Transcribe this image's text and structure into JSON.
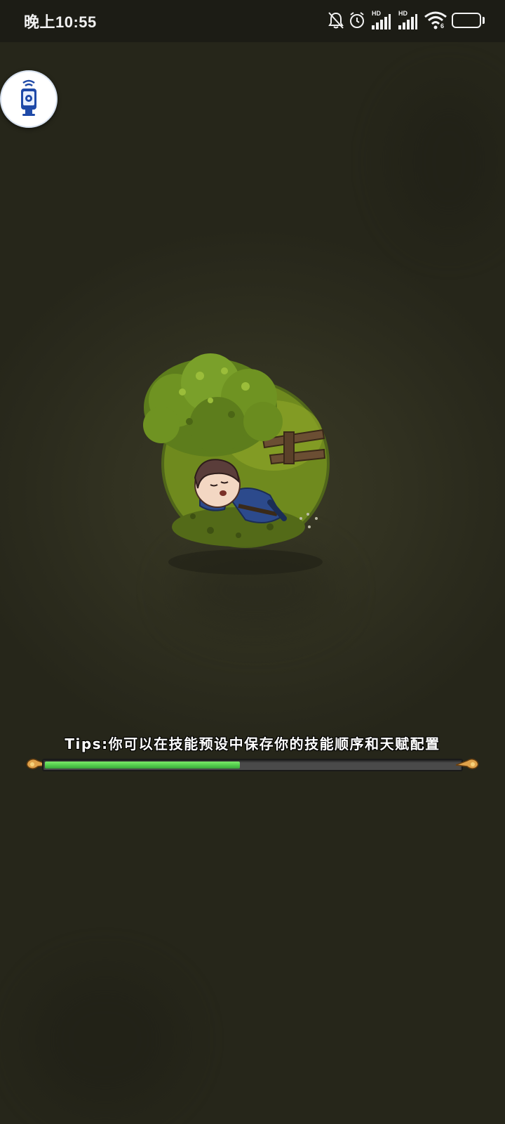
{
  "status_bar": {
    "time": "晚上10:55",
    "battery_level": "99",
    "icons": [
      "bell-muted-icon",
      "alarm-clock-icon",
      "signal-hd-icon",
      "signal-hd-icon",
      "wifi-icon",
      "battery-icon"
    ],
    "signal_labels": [
      "HD",
      "HD"
    ],
    "wifi_label": "6"
  },
  "floating_widget": {
    "icon": "camera-remote-icon"
  },
  "loading": {
    "tip": "Tips:你可以在技能预设中保存你的技能顺序和天赋配置",
    "progress": 0.47
  },
  "colors": {
    "background": "#2a2a1c",
    "progress_fill": "#4fc94a",
    "progress_track": "#4a4a4a"
  }
}
